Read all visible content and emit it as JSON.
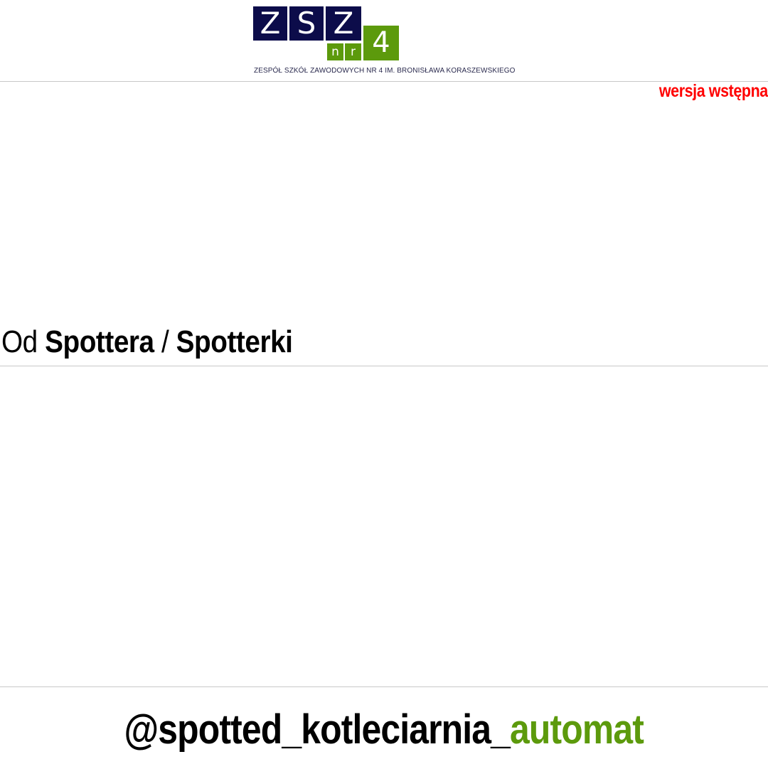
{
  "header": {
    "logo": {
      "letters": [
        "Z",
        "S",
        "Z"
      ],
      "nr": [
        "n",
        "r"
      ],
      "number": "4"
    },
    "school_name": "ZESPÓŁ SZKÓŁ ZAWODOWYCH NR 4 IM. BRONISŁAWA KORASZEWSKIEGO"
  },
  "version_label": "wersja wstępna",
  "from": {
    "prefix": "Od",
    "name_male": "Spottera",
    "separator": "/",
    "name_female": "Spotterki"
  },
  "post": {
    "text": ""
  },
  "footer": {
    "handle_main": "@spotted_kotleciarnia_",
    "handle_accent": "automat"
  },
  "colors": {
    "navy": "#0c0c4a",
    "green": "#5c9a0c",
    "red": "#ff0000",
    "divider": "#c8c8c8"
  }
}
